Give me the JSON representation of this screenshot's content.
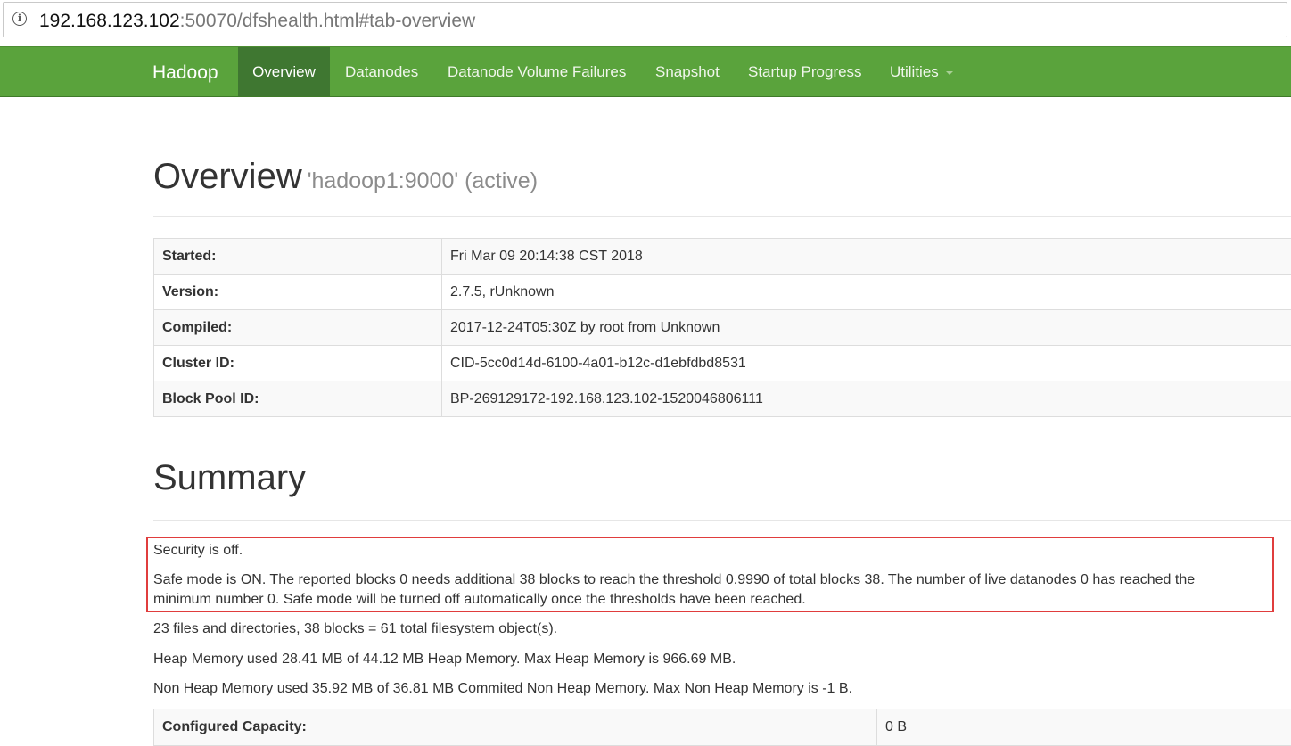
{
  "browser": {
    "url_host": "192.168.123.102",
    "url_rest": ":50070/dfshealth.html#tab-overview"
  },
  "navbar": {
    "brand": "Hadoop",
    "items": [
      {
        "label": "Overview",
        "active": true
      },
      {
        "label": "Datanodes"
      },
      {
        "label": "Datanode Volume Failures"
      },
      {
        "label": "Snapshot"
      },
      {
        "label": "Startup Progress"
      },
      {
        "label": "Utilities",
        "dropdown": true
      }
    ]
  },
  "overview": {
    "title": "Overview",
    "subtitle": "'hadoop1:9000' (active)",
    "rows": [
      {
        "key": "Started:",
        "value": "Fri Mar 09 20:14:38 CST 2018"
      },
      {
        "key": "Version:",
        "value": "2.7.5, rUnknown"
      },
      {
        "key": "Compiled:",
        "value": "2017-12-24T05:30Z by root from Unknown"
      },
      {
        "key": "Cluster ID:",
        "value": "CID-5cc0d14d-6100-4a01-b12c-d1ebfdbd8531"
      },
      {
        "key": "Block Pool ID:",
        "value": "BP-269129172-192.168.123.102-1520046806111"
      }
    ]
  },
  "summary": {
    "title": "Summary",
    "security": "Security is off.",
    "safe_mode_line1": "Safe mode is ON. The reported blocks 0 needs additional 38 blocks to reach the threshold 0.9990 of total blocks 38. The number of live datanodes 0 has reached the",
    "safe_mode_line2": "minimum number 0. Safe mode will be turned off automatically once the thresholds have been reached.",
    "files": "23 files and directories, 38 blocks = 61 total filesystem object(s).",
    "heap": "Heap Memory used 28.41 MB of 44.12 MB Heap Memory. Max Heap Memory is 966.69 MB.",
    "non_heap": "Non Heap Memory used 35.92 MB of 36.81 MB Commited Non Heap Memory. Max Non Heap Memory is -1 B.",
    "config_row": {
      "key": "Configured Capacity:",
      "value": "0 B"
    }
  },
  "colors": {
    "navbar": "#5aa33c",
    "navbar_active": "#3f7731",
    "highlight_border": "#e03d3d"
  }
}
